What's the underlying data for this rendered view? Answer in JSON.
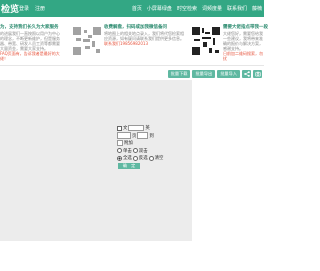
{
  "topbar": {
    "brand": "检览",
    "nav_left": [
      "登录",
      "注册"
    ],
    "nav_right": [
      "首页",
      "小屏幕绿盘",
      "时空检索",
      "词频度量",
      "联系我们",
      "藤楠"
    ]
  },
  "promos": [
    {
      "title": "为，支持我们长久为大家服务",
      "body": "的进展我们一直按照以用户为中心的理念，不断更新维护，但是服务器、带宽、研发人员工资等都需要大量资金，需要大家支持。",
      "link": "FAQ页面有，告诉我者是最好的大佬！"
    },
    {
      "title": "收费解盘，扫码或加我微信备问",
      "body": "将地图上的相关地点录入，我们将代您检索相应资源，如有疑问请联系我们提供更多信息。",
      "link": "联系我们19856982013"
    },
    {
      "title": "需要大佬指点带我一段",
      "body": "大佬您好，需要您给我一些建议，我将带来准确的报价与解决方案，感谢支持。",
      "link": "日前加二维码搜索，勿扰"
    }
  ],
  "tools": {
    "buttons": [
      "批量下载",
      "批量导出",
      "批量导入"
    ],
    "icons": [
      "share-icon",
      "camera-icon"
    ]
  },
  "form": {
    "row1_text": "文",
    "row1_suffix": "英",
    "row2_labels": [
      "页",
      "到"
    ],
    "row3_label": "附加",
    "radio_row1": [
      "单击",
      "双击"
    ],
    "radio_row2": [
      "全选",
      "反选",
      "清空"
    ],
    "submit": "确　定"
  },
  "colors": {
    "accent": "#33a784",
    "button": "#5fb8a1",
    "canvas": "#ececec",
    "link": "#e6553e"
  }
}
